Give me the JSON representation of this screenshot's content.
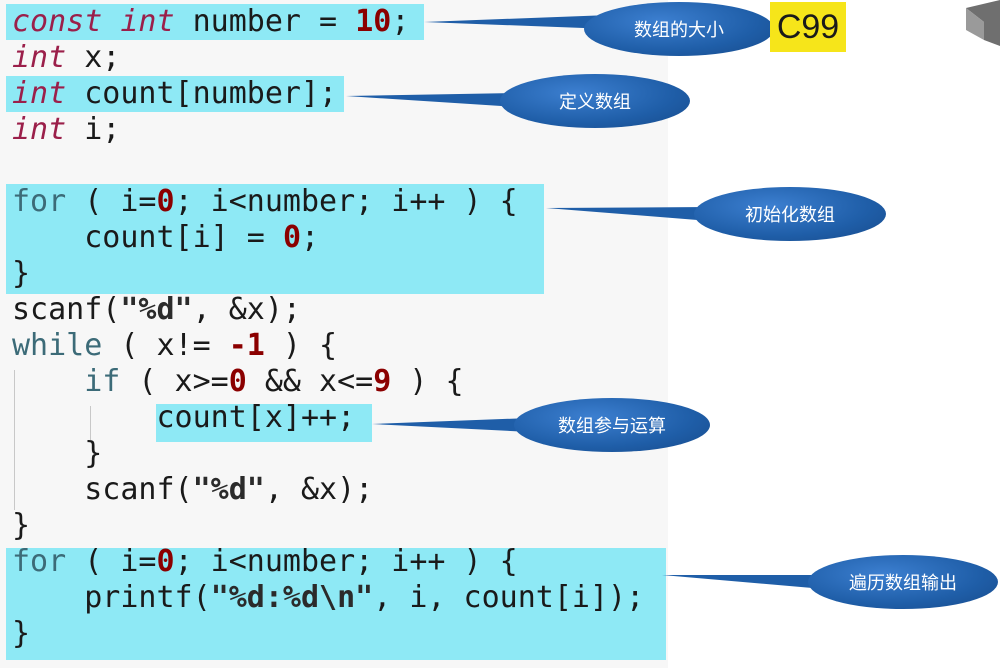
{
  "code": {
    "lines": [
      [
        {
          "t": "const ",
          "c": "kw2"
        },
        {
          "t": "int",
          "c": "kw2"
        },
        {
          "t": " number = ",
          "c": "fn"
        },
        {
          "t": "10",
          "c": "num"
        },
        {
          "t": ";",
          "c": "fn"
        }
      ],
      [
        {
          "t": "int",
          "c": "kw"
        },
        {
          "t": " x;",
          "c": "fn"
        }
      ],
      [
        {
          "t": "int",
          "c": "kw"
        },
        {
          "t": " count[number];",
          "c": "fn"
        }
      ],
      [
        {
          "t": "int",
          "c": "kw"
        },
        {
          "t": " i;",
          "c": "fn"
        }
      ],
      [],
      [
        {
          "t": "for",
          "c": "key"
        },
        {
          "t": " ( i=",
          "c": "fn"
        },
        {
          "t": "0",
          "c": "num"
        },
        {
          "t": "; i<number; i++ ) {",
          "c": "fn"
        }
      ],
      [
        {
          "t": "    count[i] = ",
          "c": "fn"
        },
        {
          "t": "0",
          "c": "num"
        },
        {
          "t": ";",
          "c": "fn"
        }
      ],
      [
        {
          "t": "}",
          "c": "fn"
        }
      ],
      [
        {
          "t": "scanf(",
          "c": "fn"
        },
        {
          "t": "\"%d\"",
          "c": "str"
        },
        {
          "t": ", &x);",
          "c": "fn"
        }
      ],
      [
        {
          "t": "while",
          "c": "key"
        },
        {
          "t": " ( x!= ",
          "c": "fn"
        },
        {
          "t": "-1",
          "c": "num"
        },
        {
          "t": " ) {",
          "c": "fn"
        }
      ],
      [
        {
          "t": "    ",
          "c": "fn"
        },
        {
          "t": "if",
          "c": "key"
        },
        {
          "t": " ( x>=",
          "c": "fn"
        },
        {
          "t": "0",
          "c": "num"
        },
        {
          "t": " && x<=",
          "c": "fn"
        },
        {
          "t": "9",
          "c": "num"
        },
        {
          "t": " ) {",
          "c": "fn"
        }
      ],
      [
        {
          "t": "        count[x]++;",
          "c": "fn"
        }
      ],
      [
        {
          "t": "    }",
          "c": "fn"
        }
      ],
      [
        {
          "t": "    scanf(",
          "c": "fn"
        },
        {
          "t": "\"%d\"",
          "c": "str"
        },
        {
          "t": ", &x);",
          "c": "fn"
        }
      ],
      [
        {
          "t": "}",
          "c": "fn"
        }
      ],
      [
        {
          "t": "for",
          "c": "key"
        },
        {
          "t": " ( i=",
          "c": "fn"
        },
        {
          "t": "0",
          "c": "num"
        },
        {
          "t": "; i<number; i++ ) {",
          "c": "fn"
        }
      ],
      [
        {
          "t": "    printf(",
          "c": "fn"
        },
        {
          "t": "\"%d:%d\\n\"",
          "c": "str"
        },
        {
          "t": ", i, count[i]);",
          "c": "fn"
        }
      ],
      [
        {
          "t": "}",
          "c": "fn"
        }
      ]
    ]
  },
  "callouts": {
    "array_size": "数组的大小",
    "define_array": "定义数组",
    "init_array": "初始化数组",
    "array_compute": "数组参与运算",
    "traverse_output": "遍历数组输出"
  },
  "badge": "C99",
  "colors": {
    "highlight": "#8ee9f5",
    "bubble": "#1f5ea8",
    "badge": "#f6e51a"
  }
}
